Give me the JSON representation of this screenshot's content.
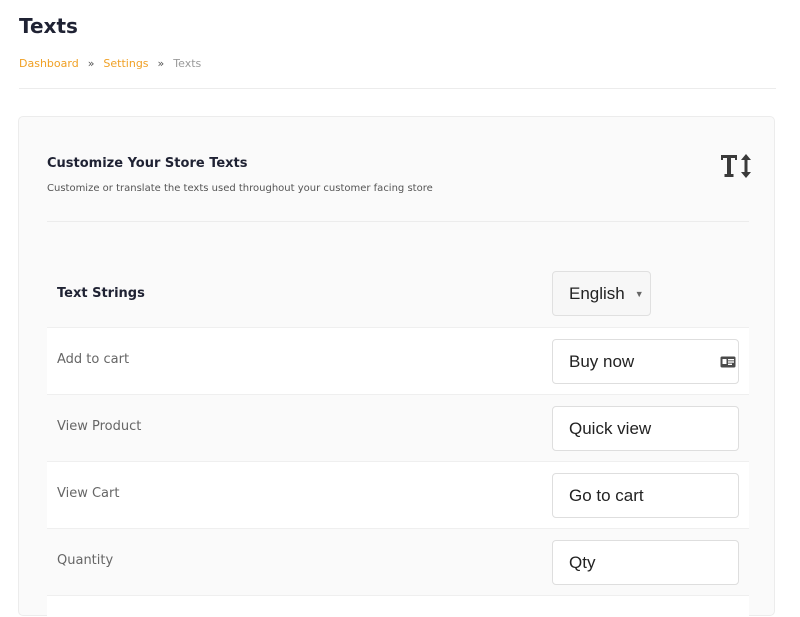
{
  "page": {
    "title": "Texts"
  },
  "breadcrumb": {
    "items": [
      "Dashboard",
      "Settings"
    ],
    "separator": "»",
    "current": "Texts"
  },
  "card": {
    "title": "Customize Your Store Texts",
    "subtitle": "Customize or translate the texts used throughout your customer facing store",
    "icon": "text-size-icon"
  },
  "strings": {
    "header_label": "Text Strings",
    "language": {
      "selected": "English"
    },
    "rows": [
      {
        "label": "Add to cart",
        "value": "Buy now",
        "icon": "contact-card-icon"
      },
      {
        "label": "View Product",
        "value": "Quick view"
      },
      {
        "label": "View Cart",
        "value": "Go to cart"
      },
      {
        "label": "Quantity",
        "value": "Qty"
      }
    ]
  },
  "colors": {
    "accent": "#f0a024",
    "muted": "#9a9a9a",
    "heading": "#1f2233"
  }
}
